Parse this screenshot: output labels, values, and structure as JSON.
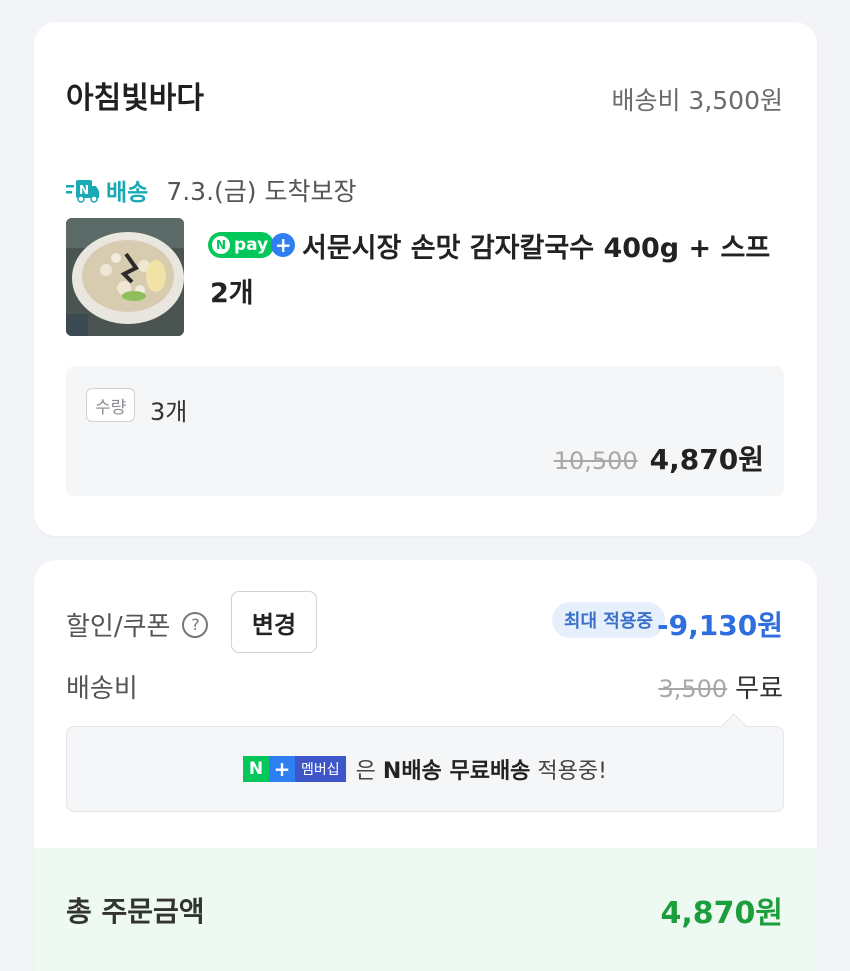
{
  "store": {
    "name": "아침빛바다",
    "shipping_fee": "배송비 3,500원",
    "delivery_brand": "배송",
    "arrival": "7.3.(금) 도착보장"
  },
  "product": {
    "npay_text": "pay",
    "npay_n": "N",
    "name": "서문시장 손맛 감자칼국수 400g + 스프 2개",
    "qty_tag": "수량",
    "qty_value": "3개",
    "original_price": "10,500",
    "final_price": "4,870원"
  },
  "summary": {
    "discount_label": "할인/쿠폰",
    "help_glyph": "?",
    "change_button": "변경",
    "max_badge": "최대 적용중",
    "discount_amount": "-9,130원",
    "fee_label": "배송비",
    "fee_original": "3,500",
    "fee_free": "무료",
    "member_n": "N",
    "member_plus": "+",
    "member_ship": "멤버십",
    "member_text_pre": "은 ",
    "member_text_bold": "N배송 무료배송",
    "member_text_post": " 적용중!",
    "total_label": "총 주문금액",
    "total_amount": "4,870원"
  },
  "colors": {
    "npay_green": "#03c75a",
    "plus_blue": "#2e7ff1",
    "discount_blue": "#2f6ede",
    "total_green": "#1d9e3c",
    "delivery_teal": "#19aab4"
  }
}
